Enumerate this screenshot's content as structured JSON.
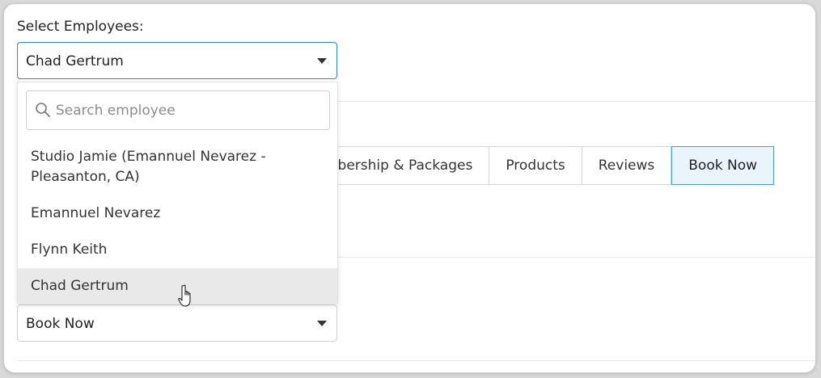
{
  "form": {
    "select_label": "Select Employees:",
    "selected_employee": "Chad Gertrum",
    "search_placeholder": "Search employee",
    "options": [
      {
        "line1": "Studio Jamie (Emannuel Nevarez -",
        "line2": "Pleasanton, CA)"
      },
      {
        "line1": "Emannuel Nevarez"
      },
      {
        "line1": "Flynn Keith"
      },
      {
        "line1": "Chad Gertrum"
      }
    ],
    "hovered_option": "Chad Gertrum",
    "section_select_value": "Book Now"
  },
  "tabs": [
    {
      "label": "mbership & Packages"
    },
    {
      "label": "Products"
    },
    {
      "label": "Reviews"
    },
    {
      "label": "Book Now",
      "active": true
    }
  ],
  "icons": {
    "search": "search-icon",
    "caret": "caret-down-icon",
    "cursor": "hand-pointer-icon"
  },
  "colors": {
    "accent_border": "#2a86c4",
    "active_tab_bg": "#eaf4fc",
    "hover_bg": "#e9e9e9"
  }
}
